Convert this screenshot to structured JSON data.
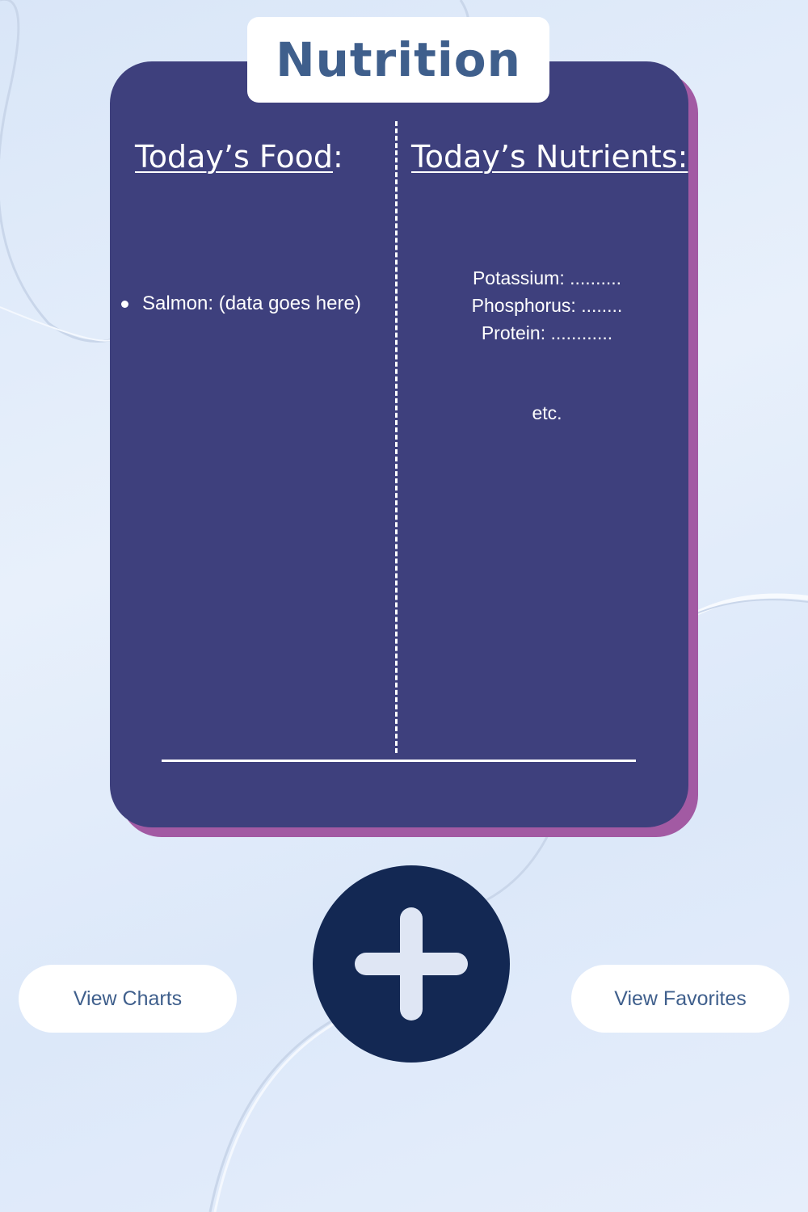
{
  "header": {
    "title": "Nutrition"
  },
  "food_column": {
    "heading": "Today’s Food",
    "heading_suffix": ":",
    "items": [
      {
        "label": "Salmon: (data goes here)"
      }
    ]
  },
  "nutrients_column": {
    "heading": "Today’s Nutrients:",
    "items": [
      {
        "label": "Potassium: .........."
      },
      {
        "label": "Phosphorus: ........"
      },
      {
        "label": "Protein: ............"
      }
    ],
    "more": "etc."
  },
  "actions": {
    "view_charts": "View Charts",
    "view_favorites": "View Favorites",
    "add_icon": "plus-icon"
  },
  "colors": {
    "card": "#3e407d",
    "card_shadow": "#a25aa3",
    "title_text": "#3f5f8c",
    "add_button": "#132853",
    "pill_text": "#3f5f8c"
  }
}
